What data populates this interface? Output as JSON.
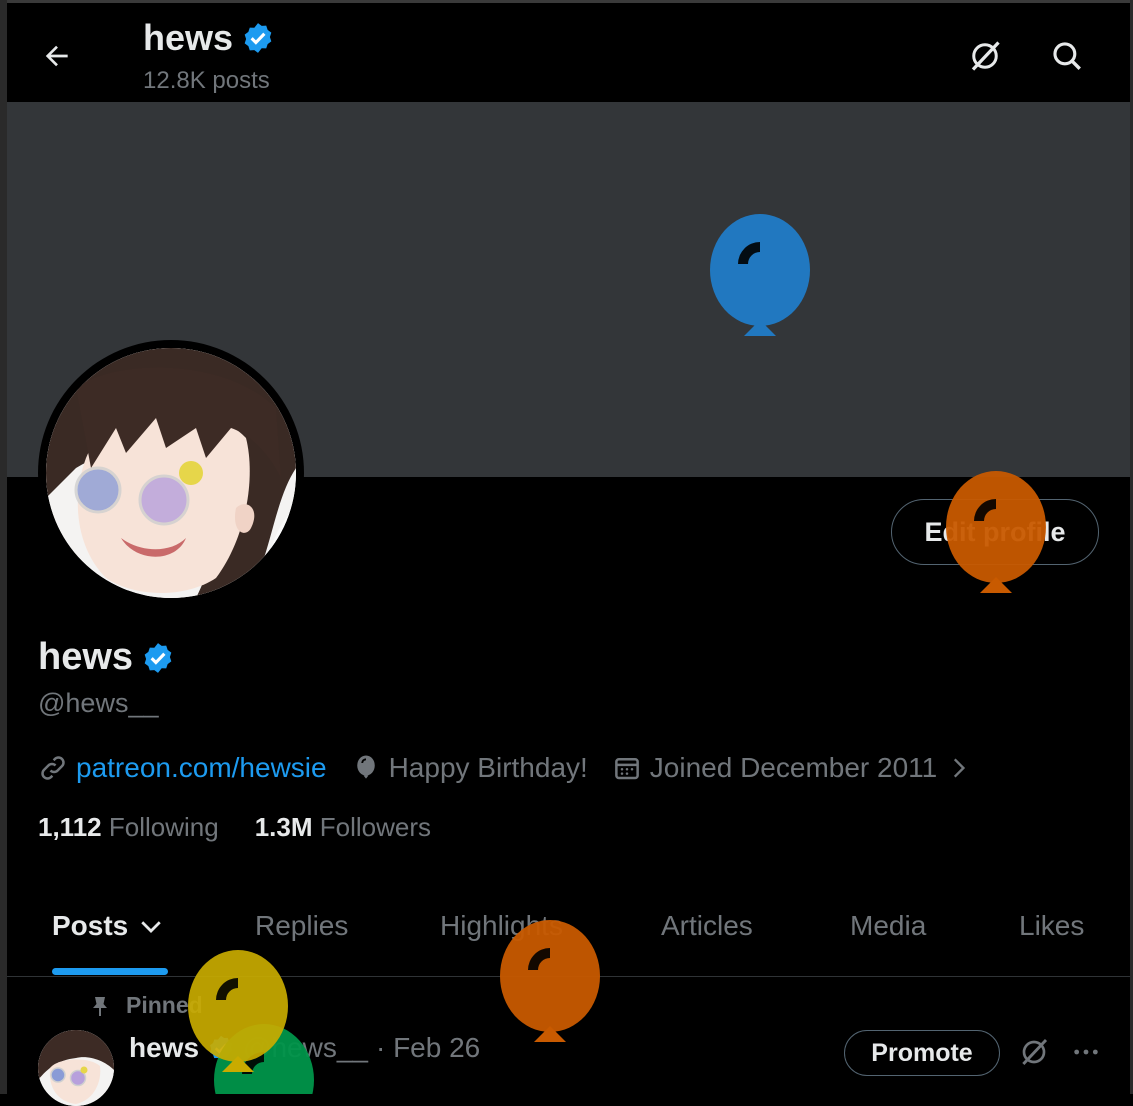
{
  "header": {
    "title": "hews",
    "post_count": "12.8K posts"
  },
  "profile": {
    "display_name": "hews",
    "handle": "@hews__",
    "edit_label": "Edit profile",
    "website": "patreon.com/hewsie",
    "birthday": "Happy Birthday!",
    "joined": "Joined December 2011",
    "following_count": "1,112",
    "following_label": "Following",
    "followers_count": "1.3M",
    "followers_label": "Followers"
  },
  "tabs": [
    {
      "label": "Posts",
      "active": true
    },
    {
      "label": "Replies"
    },
    {
      "label": "Highlights"
    },
    {
      "label": "Articles"
    },
    {
      "label": "Media"
    },
    {
      "label": "Likes"
    }
  ],
  "pinned_post": {
    "pinned_label": "Pinned",
    "name": "hews",
    "handle": "@hews__",
    "date": "· Feb 26",
    "promote_label": "Promote"
  },
  "icons": {
    "back": "arrow-left-icon",
    "grok": "grok-icon",
    "search": "search-icon",
    "verified": "verified-badge-icon",
    "link": "link-icon",
    "balloon": "balloon-icon",
    "calendar": "calendar-icon",
    "chevron": "chevron-right-icon",
    "pin": "pin-icon",
    "more": "more-icon"
  },
  "colors": {
    "accent": "#1d9bf0",
    "background": "#000000",
    "banner": "#333639",
    "muted": "#71767b",
    "text": "#e7e9ea",
    "balloon_blue": "#2178c0",
    "balloon_orange": "#c85a00",
    "balloon_yellow": "#c9ab00",
    "balloon_green": "#00954a"
  }
}
